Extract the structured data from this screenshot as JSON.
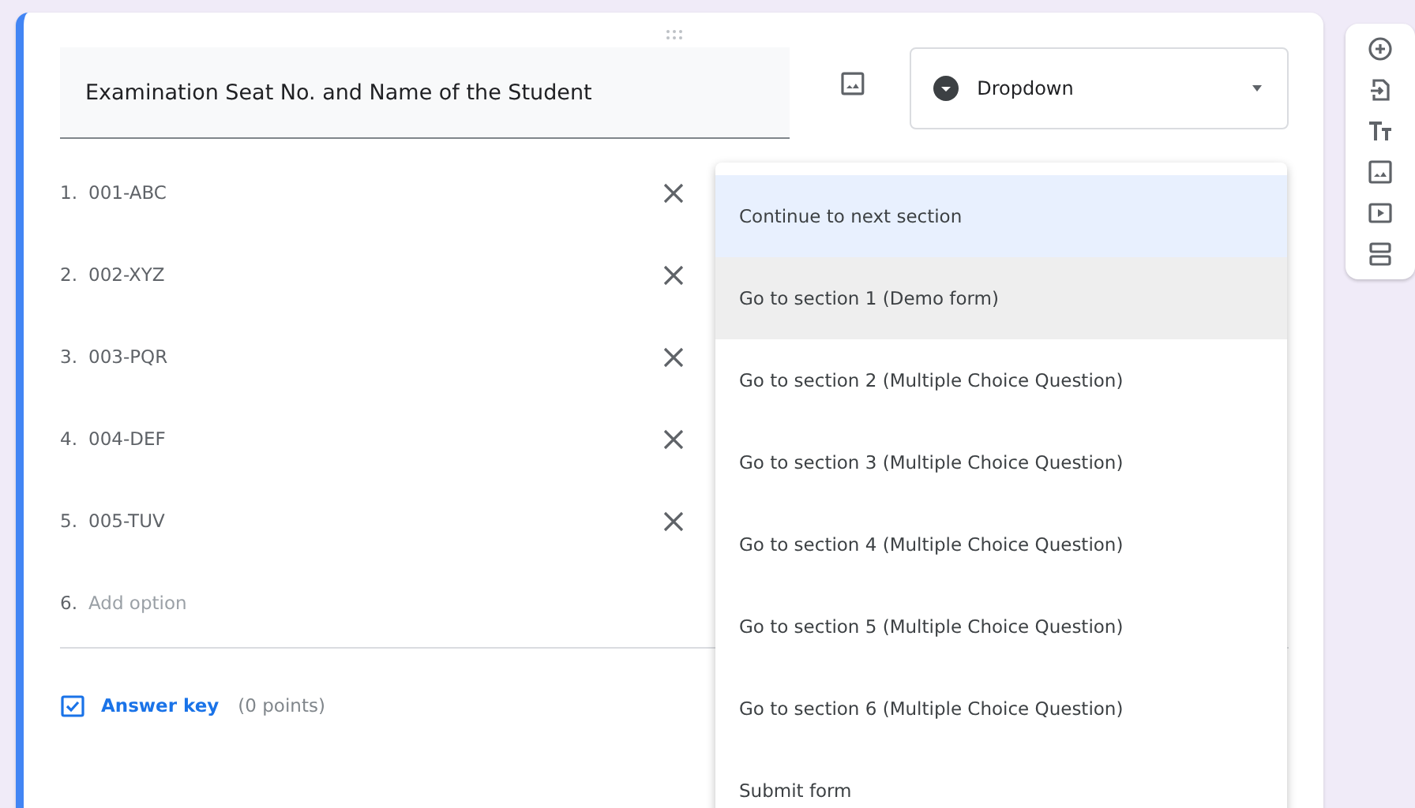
{
  "question": {
    "title": "Examination Seat No. and Name of the Student",
    "type": "Dropdown"
  },
  "options": [
    {
      "number": "1.",
      "label": "001-ABC"
    },
    {
      "number": "2.",
      "label": "002-XYZ"
    },
    {
      "number": "3.",
      "label": "003-PQR"
    },
    {
      "number": "4.",
      "label": "004-DEF"
    },
    {
      "number": "5.",
      "label": "005-TUV"
    }
  ],
  "add_option": {
    "number": "6.",
    "placeholder": "Add option"
  },
  "answer_key": {
    "label": "Answer key",
    "points": "(0 points)"
  },
  "section_menu": [
    {
      "label": "Continue to next section",
      "selected": true,
      "hovered": false
    },
    {
      "label": "Go to section 1 (Demo form)",
      "selected": false,
      "hovered": true
    },
    {
      "label": "Go to section 2 (Multiple Choice Question)",
      "selected": false,
      "hovered": false
    },
    {
      "label": "Go to section 3 (Multiple Choice Question)",
      "selected": false,
      "hovered": false
    },
    {
      "label": "Go to section 4 (Multiple Choice Question)",
      "selected": false,
      "hovered": false
    },
    {
      "label": "Go to section 5 (Multiple Choice Question)",
      "selected": false,
      "hovered": false
    },
    {
      "label": "Go to section 6 (Multiple Choice Question)",
      "selected": false,
      "hovered": false
    },
    {
      "label": "Submit form",
      "selected": false,
      "hovered": false
    }
  ]
}
